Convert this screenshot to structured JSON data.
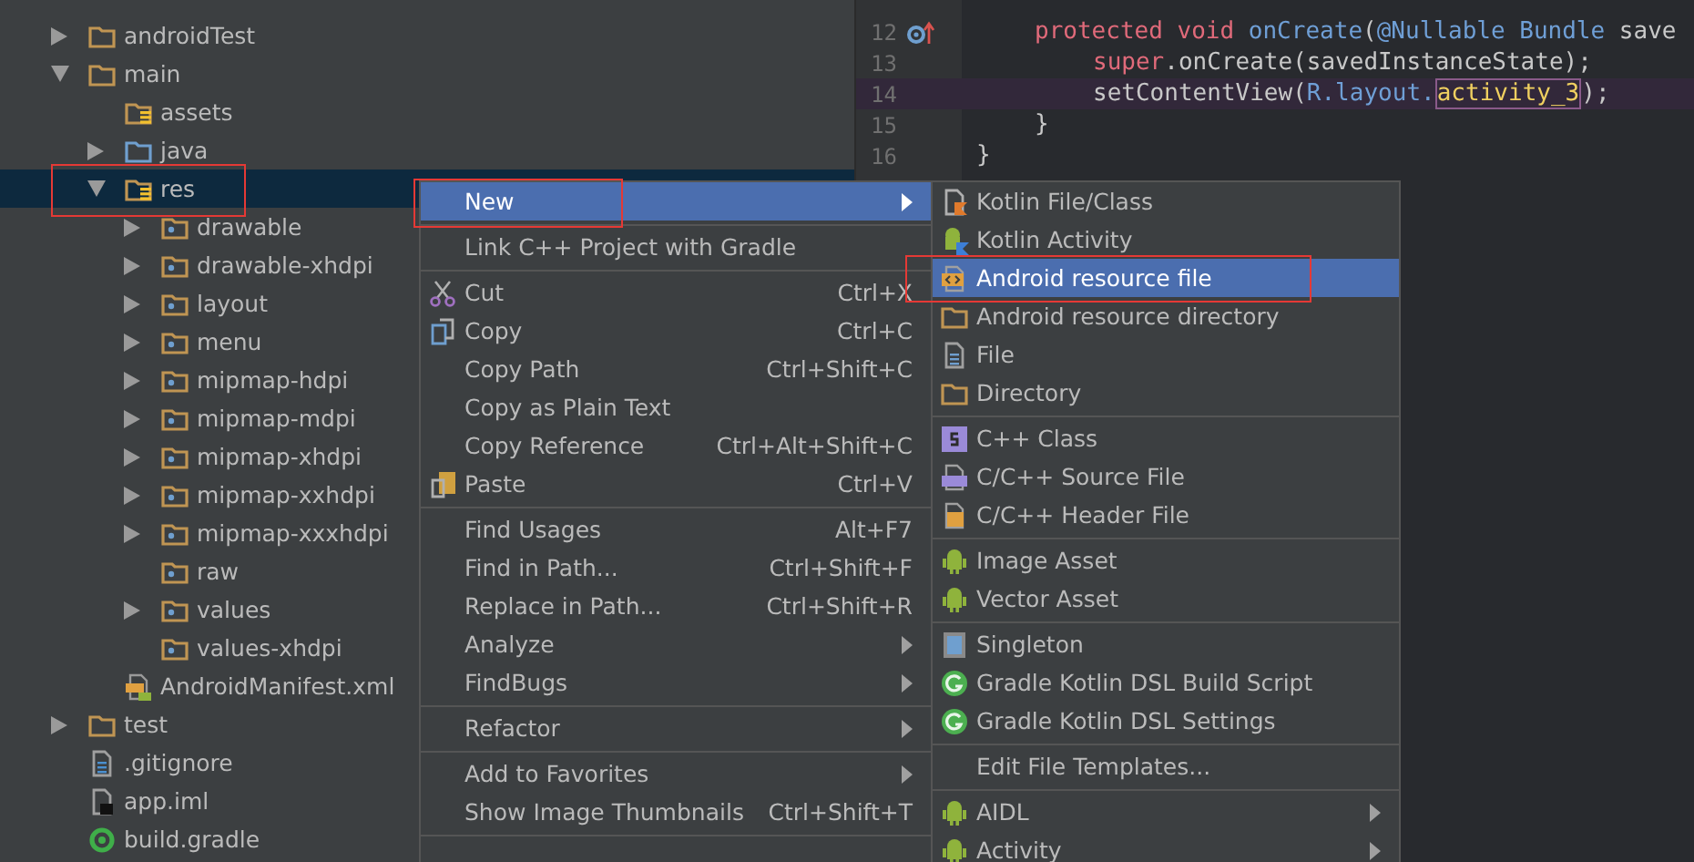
{
  "project_tree": [
    {
      "label": "androidTest",
      "kind": "folder",
      "expanded": false,
      "selected": false,
      "outlined": false
    },
    {
      "label": "main",
      "kind": "folder",
      "expanded": true,
      "selected": false,
      "outlined": false,
      "children": [
        {
          "label": "assets",
          "kind": "resource-folder",
          "selected": false,
          "outlined": false
        },
        {
          "label": "java",
          "kind": "source-folder",
          "expanded": false,
          "selected": false,
          "outlined": false
        },
        {
          "label": "res",
          "kind": "resource-folder",
          "expanded": true,
          "selected": true,
          "outlined": true,
          "children": [
            {
              "label": "drawable",
              "kind": "package-folder",
              "expanded": false,
              "selected": false,
              "outlined": false
            },
            {
              "label": "drawable-xhdpi",
              "kind": "package-folder",
              "expanded": false,
              "selected": false,
              "outlined": false
            },
            {
              "label": "layout",
              "kind": "package-folder",
              "expanded": false,
              "selected": false,
              "outlined": false
            },
            {
              "label": "menu",
              "kind": "package-folder",
              "expanded": false,
              "selected": false,
              "outlined": false
            },
            {
              "label": "mipmap-hdpi",
              "kind": "package-folder",
              "expanded": false,
              "selected": false,
              "outlined": false
            },
            {
              "label": "mipmap-mdpi",
              "kind": "package-folder",
              "expanded": false,
              "selected": false,
              "outlined": false
            },
            {
              "label": "mipmap-xhdpi",
              "kind": "package-folder",
              "expanded": false,
              "selected": false,
              "outlined": false
            },
            {
              "label": "mipmap-xxhdpi",
              "kind": "package-folder",
              "expanded": false,
              "selected": false,
              "outlined": false
            },
            {
              "label": "mipmap-xxxhdpi",
              "kind": "package-folder",
              "expanded": false,
              "selected": false,
              "outlined": false
            },
            {
              "label": "raw",
              "kind": "package-folder",
              "selected": false,
              "outlined": false
            },
            {
              "label": "values",
              "kind": "package-folder",
              "expanded": false,
              "selected": false,
              "outlined": false
            },
            {
              "label": "values-xhdpi",
              "kind": "package-folder",
              "selected": false,
              "outlined": false
            }
          ]
        },
        {
          "label": "AndroidManifest.xml",
          "kind": "manifest",
          "selected": false,
          "outlined": false
        }
      ]
    },
    {
      "label": "test",
      "kind": "folder",
      "expanded": false,
      "selected": false,
      "outlined": false
    },
    {
      "label": ".gitignore",
      "kind": "text-file",
      "selected": false,
      "outlined": false
    },
    {
      "label": "app.iml",
      "kind": "module-file",
      "selected": false,
      "outlined": false
    },
    {
      "label": "build.gradle",
      "kind": "gradle-file",
      "selected": false,
      "outlined": false
    }
  ],
  "editor": {
    "lines": [
      {
        "number": "12",
        "kind": "method",
        "override_marker": true,
        "current": false,
        "tokens": [
          {
            "kind": "keyword",
            "text": "protected void "
          },
          {
            "kind": "name",
            "text": "onCreate"
          },
          {
            "kind": "plain",
            "text": "("
          },
          {
            "kind": "name",
            "text": "@Nullable Bundle "
          },
          {
            "kind": "plain",
            "text": "save"
          }
        ]
      },
      {
        "number": "13",
        "kind": "body",
        "override_marker": false,
        "current": false,
        "tokens": [
          {
            "kind": "keyword",
            "text": "super"
          },
          {
            "kind": "plain",
            "text": ".onCreate(savedInstanceState);"
          }
        ]
      },
      {
        "number": "14",
        "kind": "body",
        "override_marker": false,
        "current": true,
        "tokens": [
          {
            "kind": "plain",
            "text": "setContentView("
          },
          {
            "kind": "name",
            "text": "R.layout."
          },
          {
            "kind": "field",
            "text": "activity_3"
          },
          {
            "kind": "plain",
            "text": ");"
          }
        ]
      },
      {
        "number": "15",
        "kind": "method",
        "override_marker": false,
        "current": false,
        "tokens": [
          {
            "kind": "plain",
            "text": "}"
          }
        ]
      },
      {
        "number": "16",
        "kind": "class",
        "override_marker": false,
        "current": false,
        "tokens": [
          {
            "kind": "plain",
            "text": "}"
          }
        ]
      }
    ]
  },
  "context_menu": [
    {
      "kind": "plain",
      "label": "New",
      "submenu": true,
      "selected": true,
      "outlined": true
    },
    {
      "kind": "separator"
    },
    {
      "kind": "plain",
      "label": "Link C++ Project with Gradle",
      "submenu": false,
      "selected": false,
      "outlined": false
    },
    {
      "kind": "separator"
    },
    {
      "kind": "scissors",
      "label": "Cut",
      "shortcut": "Ctrl+X",
      "submenu": false,
      "selected": false,
      "outlined": false
    },
    {
      "kind": "copy",
      "label": "Copy",
      "shortcut": "Ctrl+C",
      "submenu": false,
      "selected": false,
      "outlined": false
    },
    {
      "kind": "plain",
      "label": "Copy Path",
      "shortcut": "Ctrl+Shift+C",
      "submenu": false,
      "selected": false,
      "outlined": false
    },
    {
      "kind": "plain",
      "label": "Copy as Plain Text",
      "submenu": false,
      "selected": false,
      "outlined": false
    },
    {
      "kind": "plain",
      "label": "Copy Reference",
      "shortcut": "Ctrl+Alt+Shift+C",
      "submenu": false,
      "selected": false,
      "outlined": false
    },
    {
      "kind": "paste",
      "label": "Paste",
      "shortcut": "Ctrl+V",
      "submenu": false,
      "selected": false,
      "outlined": false
    },
    {
      "kind": "separator"
    },
    {
      "kind": "plain",
      "label": "Find Usages",
      "shortcut": "Alt+F7",
      "submenu": false,
      "selected": false,
      "outlined": false
    },
    {
      "kind": "plain",
      "label": "Find in Path...",
      "shortcut": "Ctrl+Shift+F",
      "submenu": false,
      "selected": false,
      "outlined": false
    },
    {
      "kind": "plain",
      "label": "Replace in Path...",
      "shortcut": "Ctrl+Shift+R",
      "submenu": false,
      "selected": false,
      "outlined": false
    },
    {
      "kind": "plain",
      "label": "Analyze",
      "submenu": true,
      "selected": false,
      "outlined": false
    },
    {
      "kind": "plain",
      "label": "FindBugs",
      "submenu": true,
      "selected": false,
      "outlined": false
    },
    {
      "kind": "separator"
    },
    {
      "kind": "plain",
      "label": "Refactor",
      "submenu": true,
      "selected": false,
      "outlined": false
    },
    {
      "kind": "separator"
    },
    {
      "kind": "plain",
      "label": "Add to Favorites",
      "submenu": true,
      "selected": false,
      "outlined": false
    },
    {
      "kind": "plain",
      "label": "Show Image Thumbnails",
      "shortcut": "Ctrl+Shift+T",
      "submenu": false,
      "selected": false,
      "outlined": false
    },
    {
      "kind": "separator"
    }
  ],
  "new_submenu": [
    {
      "kind": "kotlin-file",
      "label": "Kotlin File/Class",
      "submenu": false,
      "selected": false,
      "outlined": false
    },
    {
      "kind": "kotlin-android",
      "label": "Kotlin Activity",
      "submenu": false,
      "selected": false,
      "outlined": false
    },
    {
      "kind": "xml",
      "label": "Android resource file",
      "submenu": false,
      "selected": true,
      "outlined": true
    },
    {
      "kind": "folder",
      "label": "Android resource directory",
      "submenu": false,
      "selected": false,
      "outlined": false
    },
    {
      "kind": "file",
      "label": "File",
      "submenu": false,
      "selected": false,
      "outlined": false
    },
    {
      "kind": "folder",
      "label": "Directory",
      "submenu": false,
      "selected": false,
      "outlined": false
    },
    {
      "kind": "separator"
    },
    {
      "kind": "cpp-class",
      "label": "C++ Class",
      "submenu": false,
      "selected": false,
      "outlined": false
    },
    {
      "kind": "cpp-source",
      "label": "C/C++ Source File",
      "submenu": false,
      "selected": false,
      "outlined": false
    },
    {
      "kind": "cpp-header",
      "label": "C/C++ Header File",
      "submenu": false,
      "selected": false,
      "outlined": false
    },
    {
      "kind": "separator"
    },
    {
      "kind": "android",
      "label": "Image Asset",
      "submenu": false,
      "selected": false,
      "outlined": false
    },
    {
      "kind": "android",
      "label": "Vector Asset",
      "submenu": false,
      "selected": false,
      "outlined": false
    },
    {
      "kind": "separator"
    },
    {
      "kind": "singleton",
      "label": "Singleton",
      "submenu": false,
      "selected": false,
      "outlined": false
    },
    {
      "kind": "gradle-g",
      "label": "Gradle Kotlin DSL Build Script",
      "submenu": false,
      "selected": false,
      "outlined": false
    },
    {
      "kind": "gradle-g",
      "label": "Gradle Kotlin DSL Settings",
      "submenu": false,
      "selected": false,
      "outlined": false
    },
    {
      "kind": "separator"
    },
    {
      "kind": "plain",
      "label": "Edit File Templates...",
      "submenu": false,
      "selected": false,
      "outlined": false
    },
    {
      "kind": "separator"
    },
    {
      "kind": "android",
      "label": "AIDL",
      "submenu": true,
      "selected": false,
      "outlined": false
    },
    {
      "kind": "android",
      "label": "Activity",
      "submenu": true,
      "selected": false,
      "outlined": false
    }
  ]
}
